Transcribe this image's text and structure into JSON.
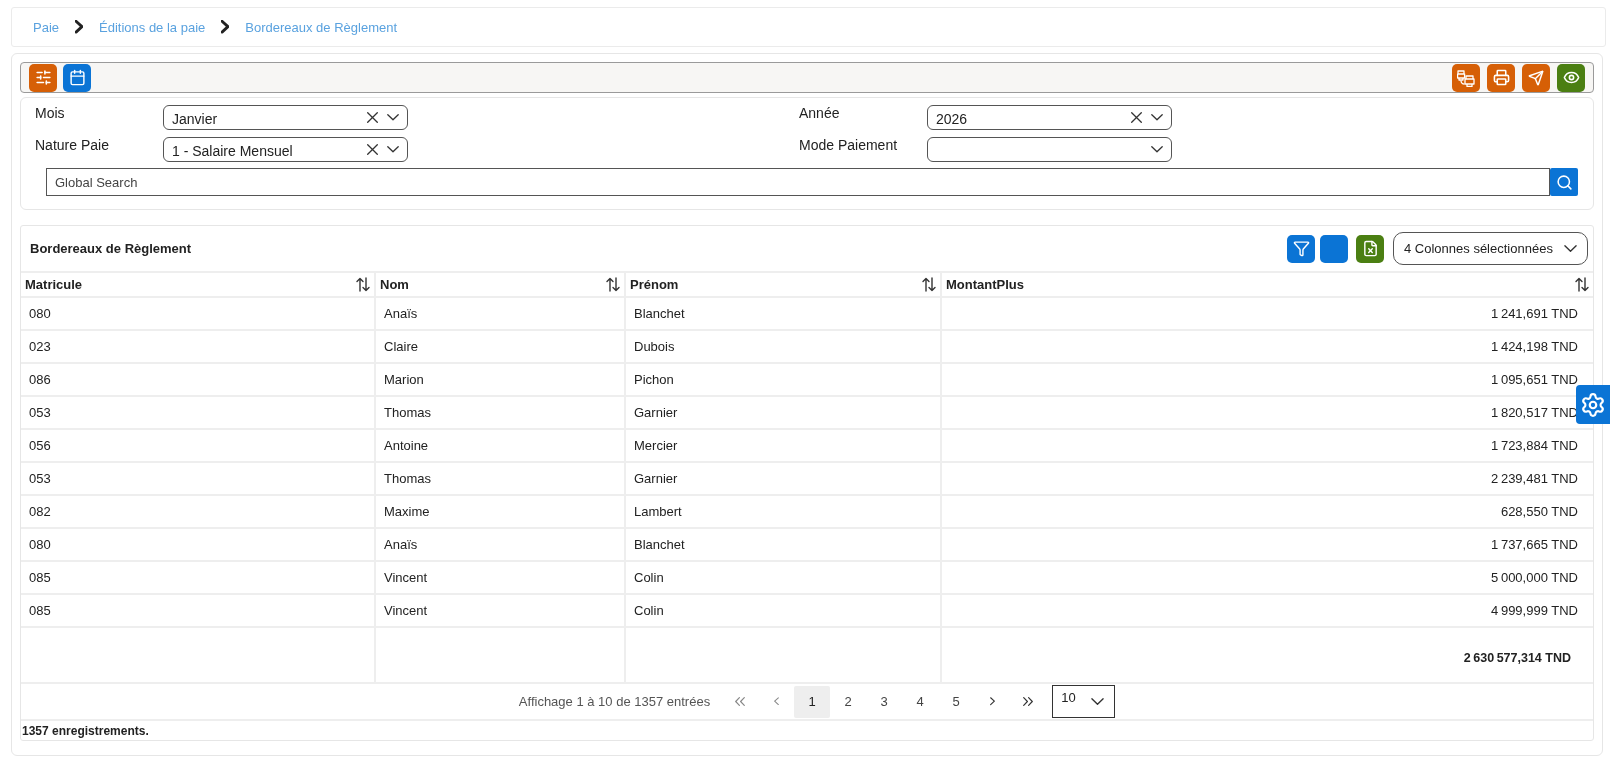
{
  "breadcrumb": [
    {
      "label": "Paie"
    },
    {
      "label": "Éditions de la paie"
    },
    {
      "label": "Bordereaux de Règlement"
    }
  ],
  "toolbar": {
    "left_buttons": [
      {
        "kind": "settings"
      },
      {
        "kind": "calendar"
      }
    ],
    "right_buttons": [
      {
        "kind": "print_batch"
      },
      {
        "kind": "print"
      },
      {
        "kind": "send"
      },
      {
        "kind": "preview"
      }
    ]
  },
  "filters": [
    {
      "label": "Mois",
      "value": "Janvier"
    },
    {
      "label": "Année",
      "value": "2026"
    },
    {
      "label": "Nature Paie",
      "value": "1 - Salaire Mensuel"
    },
    {
      "label": "Mode Paiement"
    }
  ],
  "global_search": {
    "placeholder": "Global Search"
  },
  "table": {
    "title": "Bordereaux de Règlement",
    "tools": [
      {
        "kind": "filter"
      },
      {
        "kind": "blank"
      },
      {
        "kind": "excel"
      }
    ],
    "column_picker": {
      "value": "4 Colonnes sélectionnées"
    },
    "columns": [
      "Matricule",
      "Nom",
      "Prénom",
      "MontantPlus"
    ],
    "rows": [
      [
        "080",
        "Anaïs",
        "Blanchet",
        "1 241,691 TND"
      ],
      [
        "023",
        "Claire",
        "Dubois",
        "1 424,198 TND"
      ],
      [
        "086",
        "Marion",
        "Pichon",
        "1 095,651 TND"
      ],
      [
        "053",
        "Thomas",
        "Garnier",
        "1 820,517 TND"
      ],
      [
        "056",
        "Antoine",
        "Mercier",
        "1 723,884 TND"
      ],
      [
        "053",
        "Thomas",
        "Garnier",
        "2 239,481 TND"
      ],
      [
        "082",
        "Maxime",
        "Lambert",
        "628,550 TND"
      ],
      [
        "080",
        "Anaïs",
        "Blanchet",
        "1 737,665 TND"
      ],
      [
        "085",
        "Vincent",
        "Colin",
        "5 000,000 TND"
      ],
      [
        "085",
        "Vincent",
        "Colin",
        "4 999,999 TND"
      ]
    ],
    "total": "2 630 577,314 TND"
  },
  "pagination": {
    "summary": "Affichage 1 à 10 de 1357 entrées",
    "pages": [
      {
        "label": "1",
        "selected": true
      },
      {
        "label": "2",
        "selected": false
      },
      {
        "label": "3",
        "selected": false
      },
      {
        "label": "4",
        "selected": false
      },
      {
        "label": "5",
        "selected": false
      }
    ],
    "page_size": "10"
  },
  "status": "1357 enregistrements."
}
